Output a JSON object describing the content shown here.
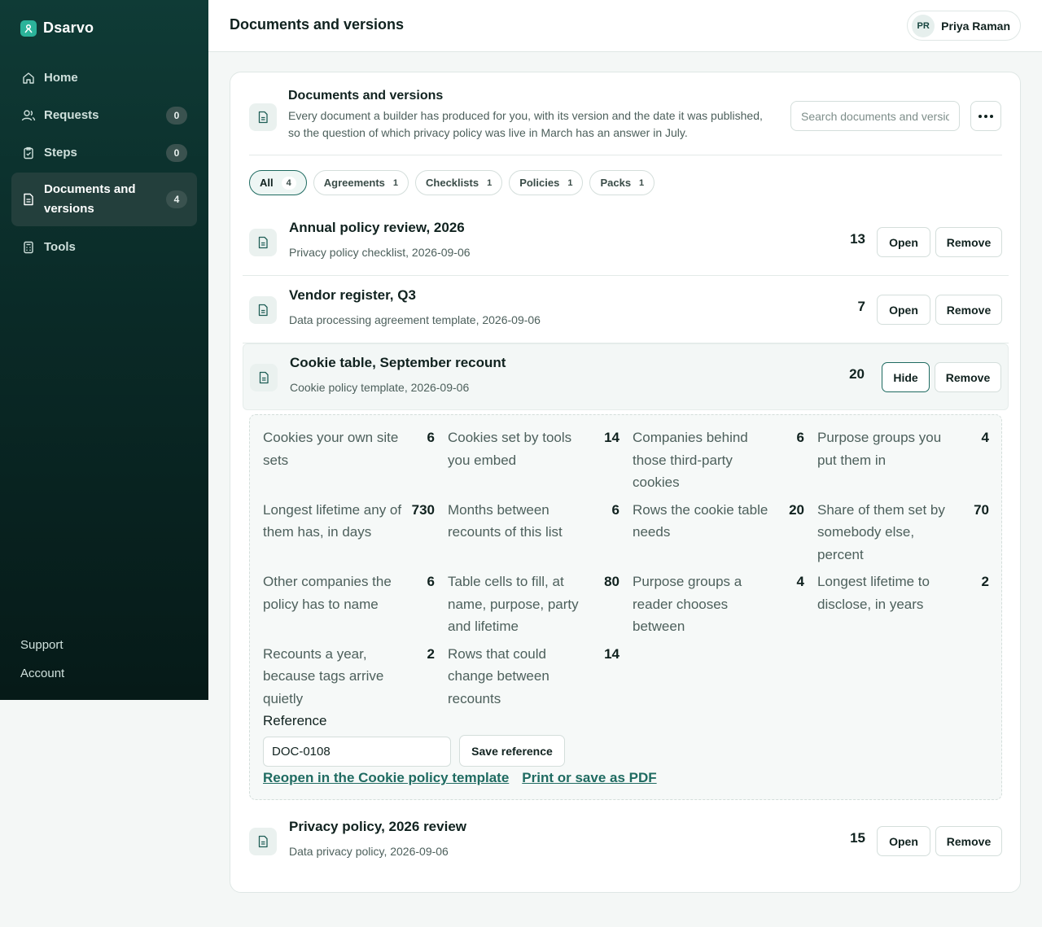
{
  "brand": {
    "name": "Dsarvo"
  },
  "sidebar": {
    "items": [
      {
        "label": "Home",
        "icon": "home-icon"
      },
      {
        "label": "Requests",
        "count": "0",
        "icon": "users-icon"
      },
      {
        "label": "Steps",
        "count": "0",
        "icon": "clipboard-icon"
      },
      {
        "label": "Documents and versions",
        "count": "4",
        "icon": "document-icon",
        "active": true
      },
      {
        "label": "Tools",
        "icon": "calculator-icon"
      }
    ],
    "footer": [
      "Support",
      "Account"
    ]
  },
  "header": {
    "title": "Documents and versions",
    "user": {
      "initials": "PR",
      "name": "Priya Raman"
    }
  },
  "card": {
    "title": "Documents and versions",
    "description": "Every document a builder has produced for you, with its version and the date it was published, so the question of which privacy policy was live in March has an answer in July.",
    "search_placeholder": "Search documents and versions"
  },
  "filters": [
    {
      "label": "All",
      "count": "4",
      "active": true
    },
    {
      "label": "Agreements",
      "count": "1"
    },
    {
      "label": "Checklists",
      "count": "1"
    },
    {
      "label": "Policies",
      "count": "1"
    },
    {
      "label": "Packs",
      "count": "1"
    }
  ],
  "documents": [
    {
      "title": "Annual policy review, 2026",
      "subtitle": "Privacy policy checklist, 2026-09-06",
      "number": "13",
      "open_label": "Open",
      "remove_label": "Remove"
    },
    {
      "title": "Vendor register, Q3",
      "subtitle": "Data processing agreement template, 2026-09-06",
      "number": "7",
      "open_label": "Open",
      "remove_label": "Remove"
    },
    {
      "title": "Cookie table, September recount",
      "subtitle": "Cookie policy template, 2026-09-06",
      "number": "20",
      "open_label": "Hide",
      "remove_label": "Remove"
    },
    {
      "title": "Privacy policy, 2026 review",
      "subtitle": "Data privacy policy, 2026-09-06",
      "number": "15",
      "open_label": "Open",
      "remove_label": "Remove"
    }
  ],
  "details": {
    "stats": [
      {
        "label": "Cookies your own site sets",
        "value": "6"
      },
      {
        "label": "Cookies set by tools you embed",
        "value": "14"
      },
      {
        "label": "Companies behind those third-party cookies",
        "value": "6"
      },
      {
        "label": "Purpose groups you put them in",
        "value": "4"
      },
      {
        "label": "Longest lifetime any of them has, in days",
        "value": "730"
      },
      {
        "label": "Months between recounts of this list",
        "value": "6"
      },
      {
        "label": "Rows the cookie table needs",
        "value": "20"
      },
      {
        "label": "Share of them set by somebody else, percent",
        "value": "70"
      },
      {
        "label": "Other companies the policy has to name",
        "value": "6"
      },
      {
        "label": "Table cells to fill, at name, purpose, party and lifetime",
        "value": "80"
      },
      {
        "label": "Purpose groups a reader chooses between",
        "value": "4"
      },
      {
        "label": "Longest lifetime to disclose, in years",
        "value": "2"
      },
      {
        "label": "Recounts a year, because tags arrive quietly",
        "value": "2"
      },
      {
        "label": "Rows that could change between recounts",
        "value": "14"
      }
    ],
    "reference_label": "Reference",
    "reference_value": "DOC-0108",
    "save_label": "Save reference",
    "reopen_link": "Reopen in the Cookie policy template",
    "print_link": "Print or save as PDF"
  }
}
